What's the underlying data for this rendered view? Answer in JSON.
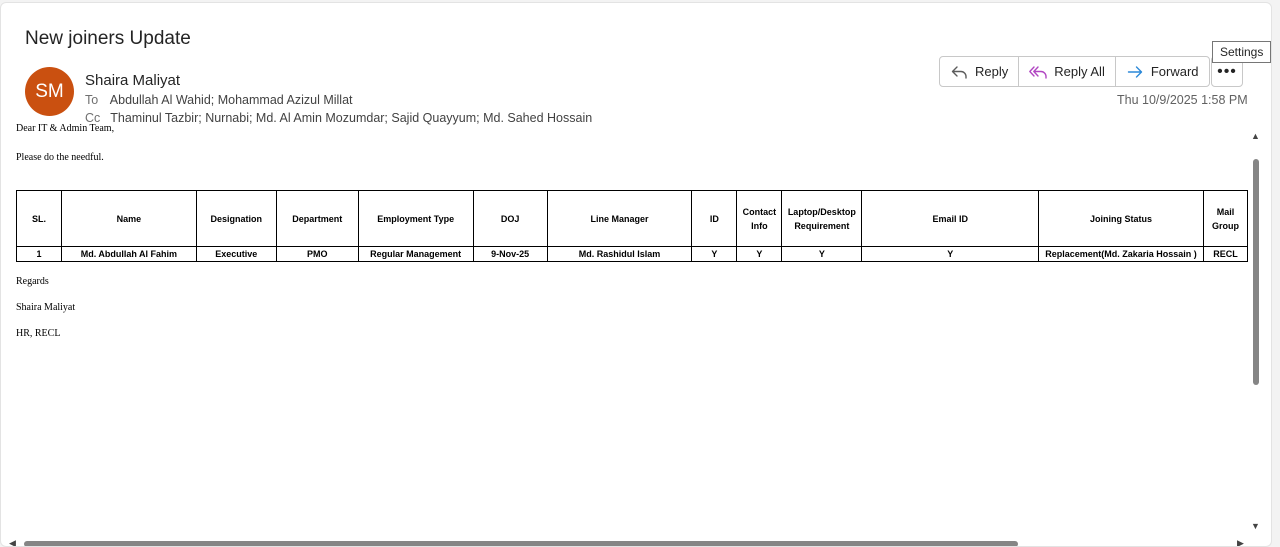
{
  "email": {
    "subject": "New joiners Update",
    "avatar_initials": "SM",
    "avatar_color": "#ca5010",
    "sender": "Shaira Maliyat",
    "to_label": "To",
    "to": "Abdullah Al Wahid; Mohammad Azizul Millat",
    "cc_label": "Cc",
    "cc": "Thaminul Tazbir; Nurnabi; Md. Al Amin Mozumdar; Sajid Quayyum; Md. Sahed Hossain",
    "date": "Thu 10/9/2025 1:58 PM"
  },
  "actions": {
    "reply": "Reply",
    "reply_all": "Reply All",
    "forward": "Forward",
    "more": "•••",
    "tooltip": "Settings"
  },
  "body": {
    "greeting": "Dear IT & Admin Team,",
    "line1": "Please do the needful.",
    "regards": "Regards",
    "signature_name": "Shaira Maliyat",
    "signature_dept": "HR, RECL"
  },
  "table": {
    "headers": [
      "SL.",
      "Name",
      "Designation",
      "Department",
      "Employment Type",
      "DOJ",
      "Line Manager",
      "ID",
      "Contact Info",
      "Laptop/Desktop Requirement",
      "Email ID",
      "Joining Status",
      "Mail Group"
    ],
    "rows": [
      [
        "1",
        "Md. Abdullah Al Fahim",
        "Executive",
        "PMO",
        "Regular Management",
        "9-Nov-25",
        "Md. Rashidul Islam",
        "Y",
        "Y",
        "Y",
        "Y",
        "Replacement(Md. Zakaria Hossain )",
        "RECL"
      ]
    ]
  }
}
